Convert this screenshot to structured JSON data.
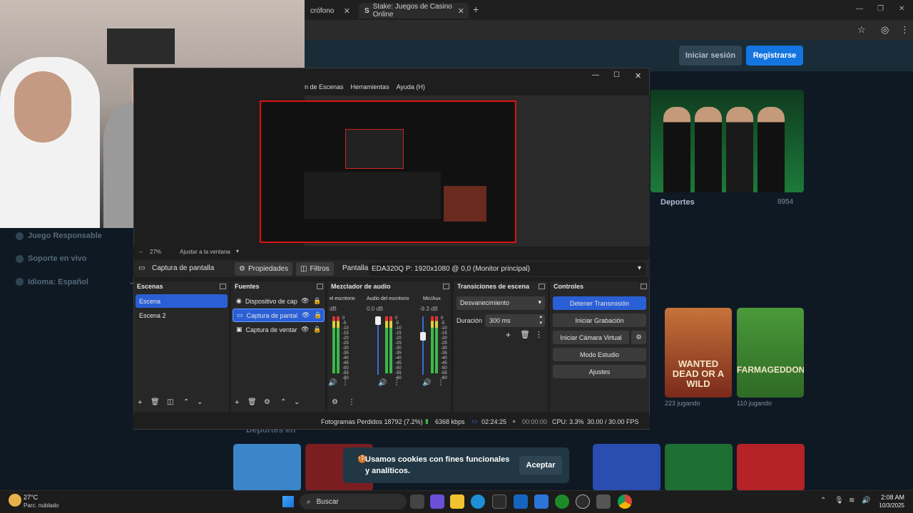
{
  "browser": {
    "tabs": [
      {
        "label": "crófono",
        "close": "✕"
      },
      {
        "label": "Stake: Juegos de Casino Online",
        "close": "✕",
        "favicon": "S"
      }
    ],
    "new_tab": "+",
    "window_controls": [
      "—",
      "❐",
      "✕"
    ]
  },
  "site": {
    "header": {
      "login": "Iniciar sesión",
      "register": "Registrarse"
    },
    "sidebar": [
      {
        "label": "Juego Responsable"
      },
      {
        "label": "Soporte en vivo"
      },
      {
        "label": "Idioma: Español",
        "chevron": "⌄"
      }
    ],
    "sports": {
      "label": "Deportes",
      "count": "8954"
    },
    "games": [
      {
        "title": "WANTED DEAD OR A WILD",
        "playing": "223",
        "playing_suffix": "jugando"
      },
      {
        "title": "FARMAGEDDON",
        "playing": "110",
        "playing_suffix": "jugando"
      }
    ],
    "section_heading": "Deportes en",
    "cookie": {
      "text": "Usamos cookies con fines funcionales y analíticos.",
      "accept": "Aceptar",
      "icon": "🍪"
    }
  },
  "obs": {
    "menu": [
      "n de Escenas",
      "Herramientas",
      "Ayuda (H)"
    ],
    "zoom": {
      "value": "27%",
      "mode": "Ajustar a la ventana"
    },
    "toolbar": {
      "source_name": "Captura de pantalla",
      "properties": "Propiedades",
      "filters": "Filtros",
      "display_label": "Pantalla",
      "display_value": "EDA320Q P: 1920x1080 @ 0,0 (Monitor principal)"
    },
    "docks": {
      "scenes": "Escenas",
      "sources": "Fuentes",
      "mixer": "Mezclador de audio",
      "transitions": "Transiciones de escena",
      "controls": "Controles"
    },
    "scenes": [
      "Escena",
      "Escena 2"
    ],
    "sources": [
      "Dispositivo de cap",
      "Captura de pantal",
      "Captura de ventar"
    ],
    "mixer": {
      "channels": [
        {
          "name": "el escritorio",
          "db": "dB"
        },
        {
          "name": "Audio del escritorio",
          "db": "0.0 dB"
        },
        {
          "name": "Mic/Aux",
          "db": "-9.3 dB"
        }
      ],
      "scale": [
        "0",
        "-5",
        "-10",
        "-15",
        "-20",
        "-25",
        "-30",
        "-35",
        "-40",
        "-45",
        "-50",
        "-55",
        "-60"
      ]
    },
    "transitions": {
      "type": "Desvanecimiento",
      "duration_label": "Duración",
      "duration_value": "300 ms"
    },
    "controls": [
      "Detener Transmisión",
      "Iniciar Grabación",
      "Iniciar Cámara Virtual",
      "Modo Estudio",
      "Ajustes"
    ],
    "status": {
      "dropped": "Fotogramas Perdidos 18792 (7.2%)",
      "bitrate": "6368 kbps",
      "stream_time": "02:24:25",
      "rec_time": "00:00:00",
      "cpu": "CPU: 3.3%",
      "fps": "30.00 / 30.00 FPS"
    }
  },
  "taskbar": {
    "weather_temp": "27°C",
    "weather_desc": "Parc. nublado",
    "search": "Buscar",
    "time": "2:08 AM",
    "date": "10/3/2025"
  },
  "colors": {
    "accent": "#2a5fd6",
    "stake_blue": "#1475e1",
    "stake_bg": "#0f1923",
    "record_red": "#dd1111"
  }
}
